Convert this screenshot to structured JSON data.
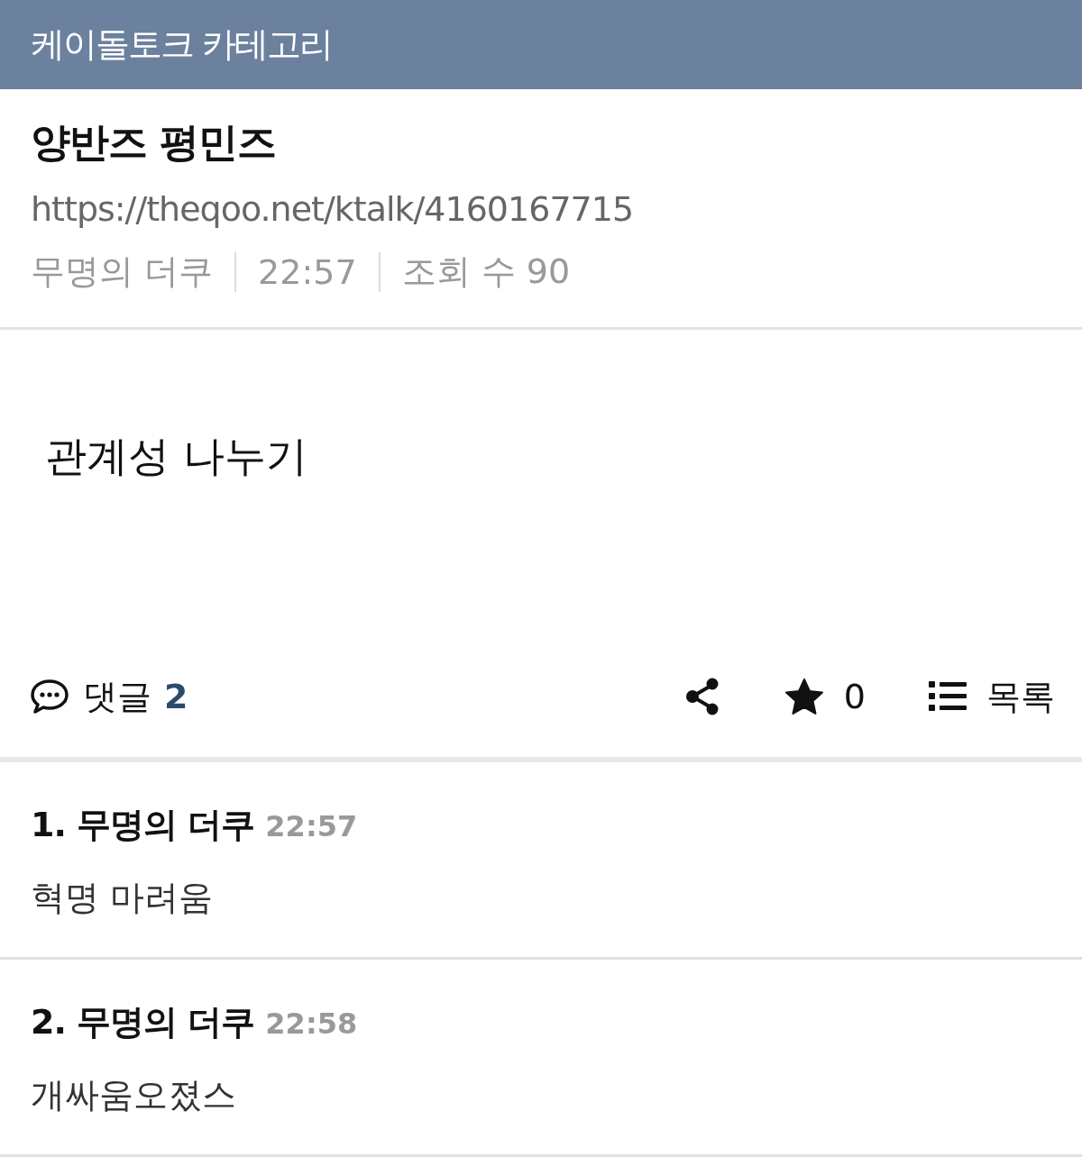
{
  "header": {
    "title": "케이돌토크 카테고리"
  },
  "post": {
    "title": "양반즈 평민즈",
    "url": "https://theqoo.net/ktalk/4160167715",
    "author": "무명의 더쿠",
    "time": "22:57",
    "views": "조회 수 90",
    "body": "관계성 나누기"
  },
  "actions": {
    "comments_label": "댓글",
    "comments_count": "2",
    "stars": "0",
    "list_label": "목록"
  },
  "comments": [
    {
      "number": "1.",
      "author": "무명의 더쿠",
      "time": "22:57",
      "text": "혁명 마려움"
    },
    {
      "number": "2.",
      "author": "무명의 더쿠",
      "time": "22:58",
      "text": "개싸움오졌스"
    }
  ]
}
